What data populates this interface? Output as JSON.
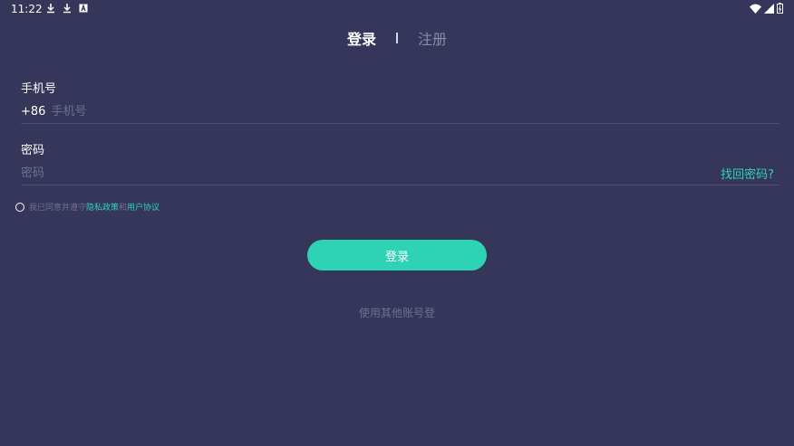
{
  "status_bar": {
    "time": "11:22",
    "left_icons": [
      "download-icon",
      "download-icon",
      "app-notification-icon"
    ],
    "right_icons": [
      "wifi-icon",
      "signal-icon",
      "battery-icon"
    ]
  },
  "tabs": {
    "login": "登录",
    "register": "注册"
  },
  "phone": {
    "label": "手机号",
    "prefix": "+86",
    "placeholder": "手机号",
    "value": ""
  },
  "password": {
    "label": "密码",
    "placeholder": "密码",
    "value": "",
    "forgot": "找回密码?"
  },
  "agreement": {
    "prefix": "我已同意并遵守",
    "privacy": "隐私政策",
    "and": "和",
    "terms": "用户协议"
  },
  "login_button": "登录",
  "other_login": "使用其他账号登",
  "colors": {
    "background": "#353659",
    "accent": "#2ed3b5"
  }
}
